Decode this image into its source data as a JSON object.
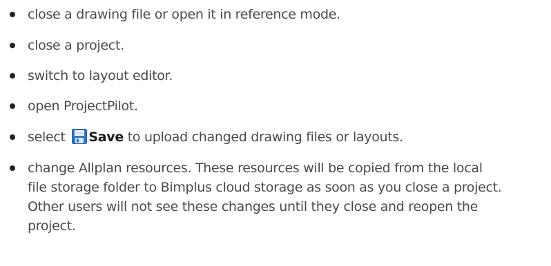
{
  "list": {
    "items": [
      {
        "text": "close a drawing file or open it in reference mode."
      },
      {
        "text": "close a project."
      },
      {
        "text": "switch to layout editor."
      },
      {
        "text": "open ProjectPilot."
      },
      {
        "prefix": "select",
        "button_label": "Save",
        "suffix": "to upload changed drawing files or layouts.",
        "icon": "floppy-disk-save-icon"
      },
      {
        "text": "change Allplan resources. These resources will be copied from the local file storage folder to Bimplus cloud storage as soon as you close a project. Other users will not see these changes until they close and reopen the project."
      }
    ]
  }
}
